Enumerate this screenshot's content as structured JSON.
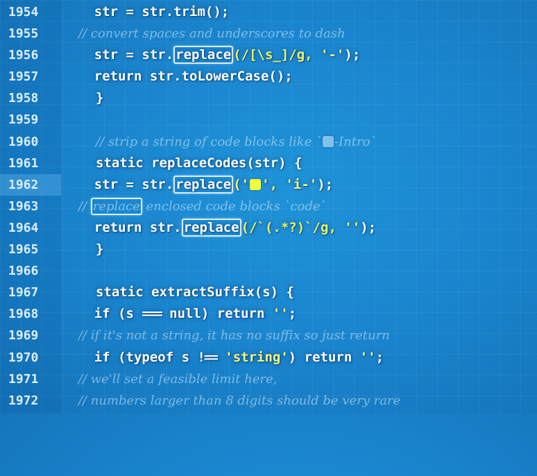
{
  "editor": {
    "lines": [
      {
        "num": "1954",
        "parts": [
          "    str = str.trim();"
        ]
      },
      {
        "num": "1955",
        "comment": "    // convert spaces and underscores to dash"
      },
      {
        "num": "1956",
        "a": "    str = str.",
        "b": "replace",
        "c": "(/[\\s_]/g, ",
        "d": "'-'",
        "e": ");"
      },
      {
        "num": "1957",
        "parts": [
          "    return str.toLowerCase();"
        ]
      },
      {
        "num": "1958",
        "parts": [
          "}"
        ]
      },
      {
        "num": "1959"
      },
      {
        "num": "1960",
        "comment_a": "// strip a string of code blocks like `",
        "comment_b": "-Intro`"
      },
      {
        "num": "1961",
        "parts": [
          "static replaceCodes(str) {"
        ]
      },
      {
        "num": "1962",
        "a": "    str = str.",
        "b": "replace",
        "c": "('",
        "d": "', ",
        "e": "'i-'",
        "f": ");"
      },
      {
        "num": "1963",
        "comment_a": "    // ",
        "comment_b": "replace",
        "comment_c": " enclosed code blocks `code`"
      },
      {
        "num": "1964",
        "a": "    return str.",
        "b": "replace",
        "c": "(/`(.*?)`/g, ",
        "d": "''",
        "e": ");"
      },
      {
        "num": "1965",
        "parts": [
          "}"
        ]
      },
      {
        "num": "1966"
      },
      {
        "num": "1967",
        "parts": [
          "static extractSuffix(s) {"
        ]
      },
      {
        "num": "1968",
        "a": "    if (s ",
        "op": "===",
        "b": " null) return ",
        "c": "''",
        "d": ";"
      },
      {
        "num": "1969",
        "comment": "    // if it's not a string, it has no suffix so just return"
      },
      {
        "num": "1970",
        "a": "    if (typeof s ",
        "op": "!==",
        "b": " ",
        "c": "'string'",
        "d": ") return ",
        "e": "''",
        "f": ";"
      },
      {
        "num": "1971",
        "comment": "    // we'll set a feasible limit here,"
      },
      {
        "num": "1972",
        "comment": "    // numbers larger than 8 digits should be very rare"
      }
    ]
  }
}
